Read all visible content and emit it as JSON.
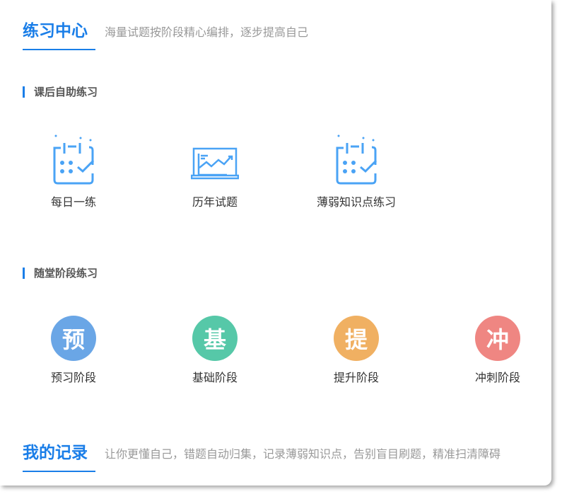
{
  "practice": {
    "title": "练习中心",
    "subtitle": "海量试题按阶段精心编排，逐步提高自己"
  },
  "self_practice": {
    "title": "课后自助练习",
    "items": [
      {
        "label": "每日一练",
        "icon": "calendar-check-icon"
      },
      {
        "label": "历年试题",
        "icon": "chart-laptop-icon"
      },
      {
        "label": "薄弱知识点练习",
        "icon": "calendar-check-icon"
      }
    ]
  },
  "stage_practice": {
    "title": "随堂阶段练习",
    "items": [
      {
        "label": "预习阶段",
        "glyph": "预",
        "color": "#6aa6e6"
      },
      {
        "label": "基础阶段",
        "glyph": "基",
        "color": "#56c8a8"
      },
      {
        "label": "提升阶段",
        "glyph": "提",
        "color": "#f0b062"
      },
      {
        "label": "冲刺阶段",
        "glyph": "冲",
        "color": "#ef8682"
      }
    ]
  },
  "records": {
    "title": "我的记录",
    "subtitle": "让你更懂自己，错题自动归集，记录薄弱知识点，告别盲目刷题，精准扫清障碍"
  }
}
